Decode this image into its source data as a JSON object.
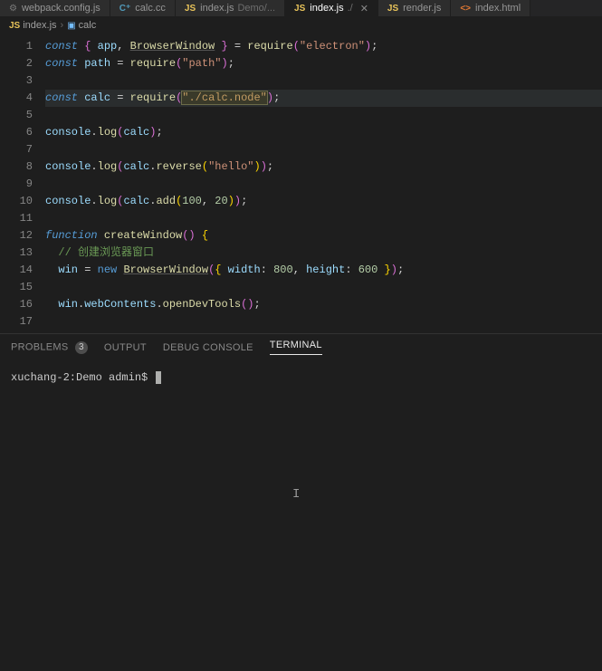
{
  "tabs": [
    {
      "icon": "cfg",
      "label": "webpack.config.js"
    },
    {
      "icon": "cpp",
      "label": "calc.cc"
    },
    {
      "icon": "js",
      "label": "index.js",
      "hint": "Demo/..."
    },
    {
      "icon": "js",
      "label": "index.js",
      "hint": "./",
      "active": true,
      "closable": true
    },
    {
      "icon": "js",
      "label": "render.js"
    },
    {
      "icon": "html",
      "label": "index.html"
    }
  ],
  "breadcrumbs": {
    "file_icon": "js",
    "file": "index.js",
    "symbol_icon": "cube",
    "symbol": "calc"
  },
  "code_lines": [
    [
      [
        "const",
        "tok-const"
      ],
      [
        " ",
        "tok-white"
      ],
      [
        "{ ",
        "tok-par"
      ],
      [
        "app",
        "tok-var"
      ],
      [
        ", ",
        "tok-pun"
      ],
      [
        "BrowserWindow",
        "tok-cls"
      ],
      [
        " }",
        "tok-par"
      ],
      [
        " = ",
        "tok-pun"
      ],
      [
        "require",
        "tok-fn"
      ],
      [
        "(",
        "tok-par"
      ],
      [
        "\"electron\"",
        "tok-str"
      ],
      [
        ")",
        "tok-par"
      ],
      [
        ";",
        "tok-pun"
      ]
    ],
    [
      [
        "const",
        "tok-const"
      ],
      [
        " ",
        "tok-white"
      ],
      [
        "path",
        "tok-var"
      ],
      [
        " = ",
        "tok-pun"
      ],
      [
        "require",
        "tok-fn"
      ],
      [
        "(",
        "tok-par"
      ],
      [
        "\"path\"",
        "tok-str"
      ],
      [
        ")",
        "tok-par"
      ],
      [
        ";",
        "tok-pun"
      ]
    ],
    [],
    [
      [
        "const",
        "tok-const"
      ],
      [
        " ",
        "tok-white"
      ],
      [
        "calc",
        "tok-var"
      ],
      [
        " = ",
        "tok-pun"
      ],
      [
        "require",
        "tok-fn"
      ],
      [
        "(",
        "tok-par"
      ],
      [
        "\"./calc.node\"",
        "tok-str hl"
      ],
      [
        ")",
        "tok-par"
      ],
      [
        ";",
        "tok-pun"
      ]
    ],
    [],
    [
      [
        "console",
        "tok-var"
      ],
      [
        ".",
        "tok-pun"
      ],
      [
        "log",
        "tok-fn"
      ],
      [
        "(",
        "tok-par"
      ],
      [
        "calc",
        "tok-var"
      ],
      [
        ")",
        "tok-par"
      ],
      [
        ";",
        "tok-pun"
      ]
    ],
    [],
    [
      [
        "console",
        "tok-var"
      ],
      [
        ".",
        "tok-pun"
      ],
      [
        "log",
        "tok-fn"
      ],
      [
        "(",
        "tok-par"
      ],
      [
        "calc",
        "tok-var"
      ],
      [
        ".",
        "tok-pun"
      ],
      [
        "reverse",
        "tok-fn"
      ],
      [
        "(",
        "tok-par2"
      ],
      [
        "\"hello\"",
        "tok-str"
      ],
      [
        ")",
        "tok-par2"
      ],
      [
        ")",
        "tok-par"
      ],
      [
        ";",
        "tok-pun"
      ]
    ],
    [],
    [
      [
        "console",
        "tok-var"
      ],
      [
        ".",
        "tok-pun"
      ],
      [
        "log",
        "tok-fn"
      ],
      [
        "(",
        "tok-par"
      ],
      [
        "calc",
        "tok-var"
      ],
      [
        ".",
        "tok-pun"
      ],
      [
        "add",
        "tok-fn"
      ],
      [
        "(",
        "tok-par2"
      ],
      [
        "100",
        "tok-num"
      ],
      [
        ", ",
        "tok-pun"
      ],
      [
        "20",
        "tok-num"
      ],
      [
        ")",
        "tok-par2"
      ],
      [
        ")",
        "tok-par"
      ],
      [
        ";",
        "tok-pun"
      ]
    ],
    [],
    [
      [
        "function",
        "tok-const"
      ],
      [
        " ",
        "tok-white"
      ],
      [
        "createWindow",
        "tok-fn"
      ],
      [
        "()",
        "tok-par"
      ],
      [
        " {",
        "tok-par2"
      ]
    ],
    [
      [
        "  // 创建浏览器窗口",
        "tok-cmt"
      ]
    ],
    [
      [
        "  ",
        "tok-white"
      ],
      [
        "win",
        "tok-var"
      ],
      [
        " = ",
        "tok-pun"
      ],
      [
        "new",
        "tok-new"
      ],
      [
        " ",
        "tok-white"
      ],
      [
        "BrowserWindow",
        "tok-cls"
      ],
      [
        "(",
        "tok-par"
      ],
      [
        "{",
        "tok-par2"
      ],
      [
        " width",
        "tok-var"
      ],
      [
        ": ",
        "tok-pun"
      ],
      [
        "800",
        "tok-num"
      ],
      [
        ", ",
        "tok-pun"
      ],
      [
        "height",
        "tok-var"
      ],
      [
        ": ",
        "tok-pun"
      ],
      [
        "600",
        "tok-num"
      ],
      [
        " }",
        "tok-par2"
      ],
      [
        ")",
        "tok-par"
      ],
      [
        ";",
        "tok-pun"
      ]
    ],
    [],
    [
      [
        "  ",
        "tok-white"
      ],
      [
        "win",
        "tok-var"
      ],
      [
        ".",
        "tok-pun"
      ],
      [
        "webContents",
        "tok-var"
      ],
      [
        ".",
        "tok-pun"
      ],
      [
        "openDevTools",
        "tok-fn"
      ],
      [
        "()",
        "tok-par"
      ],
      [
        ";",
        "tok-pun"
      ]
    ],
    []
  ],
  "highlighted_line": 4,
  "panel": {
    "problems": "PROBLEMS",
    "problems_count": "3",
    "output": "OUTPUT",
    "debug": "DEBUG CONSOLE",
    "terminal": "TERMINAL"
  },
  "terminal_prompt": "xuchang-2:Demo admin$ "
}
